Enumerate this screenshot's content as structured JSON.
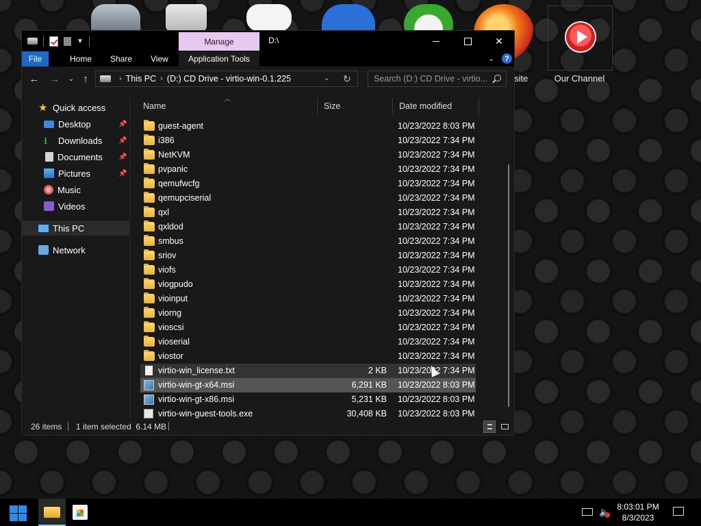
{
  "desktop": {
    "partial_label": "site",
    "channel_label": "Our Channel"
  },
  "window": {
    "title": "D:\\",
    "manage_tab": "Manage",
    "controls": {
      "minimize": "—",
      "maximize": "☐",
      "close": "✕"
    }
  },
  "ribbon": {
    "tabs": [
      "File",
      "Home",
      "Share",
      "View",
      "Application Tools"
    ],
    "help": "?"
  },
  "address": {
    "crumbs": [
      "This PC",
      "(D:) CD Drive - virtio-win-0.1.225"
    ],
    "search_placeholder": "Search (D:) CD Drive - virtio..."
  },
  "nav_pane": {
    "quick_access": "Quick access",
    "items": [
      "Desktop",
      "Downloads",
      "Documents",
      "Pictures",
      "Music",
      "Videos"
    ],
    "this_pc": "This PC",
    "network": "Network"
  },
  "columns": {
    "name": "Name",
    "size": "Size",
    "date": "Date modified"
  },
  "files": [
    {
      "name": "guest-agent",
      "size": "",
      "date": "10/23/2022 8:03 PM",
      "kind": "folder"
    },
    {
      "name": "i386",
      "size": "",
      "date": "10/23/2022 7:34 PM",
      "kind": "folder"
    },
    {
      "name": "NetKVM",
      "size": "",
      "date": "10/23/2022 7:34 PM",
      "kind": "folder"
    },
    {
      "name": "pvpanic",
      "size": "",
      "date": "10/23/2022 7:34 PM",
      "kind": "folder"
    },
    {
      "name": "qemufwcfg",
      "size": "",
      "date": "10/23/2022 7:34 PM",
      "kind": "folder"
    },
    {
      "name": "qemupciserial",
      "size": "",
      "date": "10/23/2022 7:34 PM",
      "kind": "folder"
    },
    {
      "name": "qxl",
      "size": "",
      "date": "10/23/2022 7:34 PM",
      "kind": "folder"
    },
    {
      "name": "qxldod",
      "size": "",
      "date": "10/23/2022 7:34 PM",
      "kind": "folder"
    },
    {
      "name": "smbus",
      "size": "",
      "date": "10/23/2022 7:34 PM",
      "kind": "folder"
    },
    {
      "name": "sriov",
      "size": "",
      "date": "10/23/2022 7:34 PM",
      "kind": "folder"
    },
    {
      "name": "viofs",
      "size": "",
      "date": "10/23/2022 7:34 PM",
      "kind": "folder"
    },
    {
      "name": "viogpudo",
      "size": "",
      "date": "10/23/2022 7:34 PM",
      "kind": "folder"
    },
    {
      "name": "vioinput",
      "size": "",
      "date": "10/23/2022 7:34 PM",
      "kind": "folder"
    },
    {
      "name": "viorng",
      "size": "",
      "date": "10/23/2022 7:34 PM",
      "kind": "folder"
    },
    {
      "name": "vioscsi",
      "size": "",
      "date": "10/23/2022 7:34 PM",
      "kind": "folder"
    },
    {
      "name": "vioserial",
      "size": "",
      "date": "10/23/2022 7:34 PM",
      "kind": "folder"
    },
    {
      "name": "viostor",
      "size": "",
      "date": "10/23/2022 7:34 PM",
      "kind": "folder"
    },
    {
      "name": "virtio-win_license.txt",
      "size": "2 KB",
      "date": "10/23/2022 7:34 PM",
      "kind": "txt",
      "state": "hover"
    },
    {
      "name": "virtio-win-gt-x64.msi",
      "size": "6,291 KB",
      "date": "10/23/2022 8:03 PM",
      "kind": "msi",
      "state": "selected"
    },
    {
      "name": "virtio-win-gt-x86.msi",
      "size": "5,231 KB",
      "date": "10/23/2022 8:03 PM",
      "kind": "msi"
    },
    {
      "name": "virtio-win-guest-tools.exe",
      "size": "30,408 KB",
      "date": "10/23/2022 8:03 PM",
      "kind": "exe"
    }
  ],
  "status": {
    "count": "26 items",
    "selected": "1 item selected  6.14 MB"
  },
  "taskbar": {
    "time": "8:03:01 PM",
    "date": "8/3/2023"
  }
}
